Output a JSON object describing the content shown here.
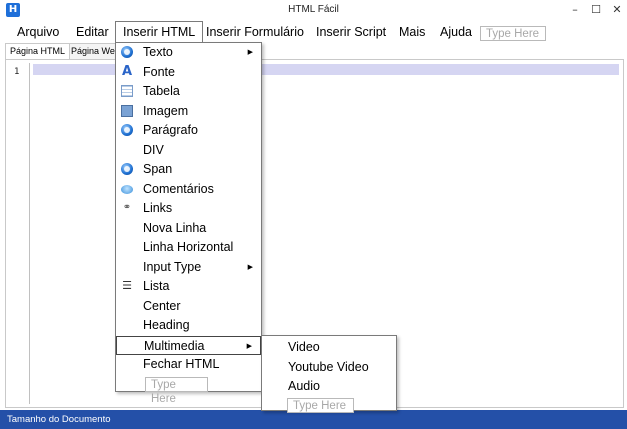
{
  "window": {
    "app_icon_letter": "H",
    "title": "HTML Fácil",
    "minimize_glyph": "–",
    "maximize_glyph": "☐",
    "close_glyph": "✕"
  },
  "menubar": {
    "items": [
      "Arquivo",
      "Editar",
      "Inserir HTML",
      "Inserir Formulário",
      "Inserir Script",
      "Mais",
      "Ajuda"
    ],
    "type_here": "Type Here"
  },
  "tabs": [
    "Página HTML",
    "Página Web"
  ],
  "editor": {
    "line_number": "1"
  },
  "dropdown": {
    "items": [
      {
        "label": "Texto",
        "icon": "globe-icon",
        "submenu": true
      },
      {
        "label": "Fonte",
        "icon": "font-icon",
        "submenu": false
      },
      {
        "label": "Tabela",
        "icon": "table-icon",
        "submenu": false
      },
      {
        "label": "Imagem",
        "icon": "image-icon",
        "submenu": false
      },
      {
        "label": "Parágrafo",
        "icon": "globe-icon",
        "submenu": false
      },
      {
        "label": "DIV",
        "icon": "",
        "submenu": false
      },
      {
        "label": "Span",
        "icon": "globe-icon",
        "submenu": false
      },
      {
        "label": "Comentários",
        "icon": "comment-icon",
        "submenu": false
      },
      {
        "label": "Links",
        "icon": "link-icon",
        "submenu": false
      },
      {
        "label": "Nova Linha",
        "icon": "",
        "submenu": false
      },
      {
        "label": "Linha Horizontal",
        "icon": "",
        "submenu": false
      },
      {
        "label": "Input Type",
        "icon": "",
        "submenu": true
      },
      {
        "label": "Lista",
        "icon": "list-icon",
        "submenu": false
      },
      {
        "label": "Center",
        "icon": "",
        "submenu": false
      },
      {
        "label": "Heading",
        "icon": "",
        "submenu": false
      },
      {
        "label": "Multimedia",
        "icon": "",
        "submenu": true
      },
      {
        "label": "Fechar  HTML",
        "icon": "",
        "submenu": false
      }
    ],
    "type_here": "Type Here",
    "highlighted": "Multimedia"
  },
  "submenu": {
    "items": [
      "Video",
      "Youtube Video",
      "Audio"
    ],
    "type_here": "Type Here"
  },
  "statusbar": {
    "text": "Tamanho do Documento"
  },
  "colors": {
    "statusbar_bg": "#2450a8",
    "current_line": "#d5d5f2",
    "app_icon": "#1e6fd9"
  }
}
